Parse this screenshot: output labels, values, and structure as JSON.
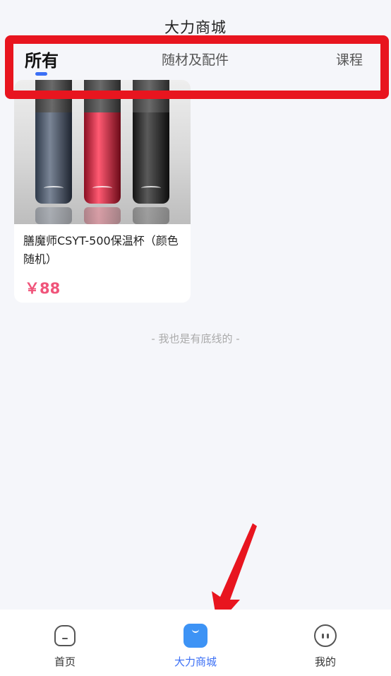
{
  "header": {
    "title": "大力商城"
  },
  "tabs": [
    {
      "label": "所有",
      "active": true
    },
    {
      "label": "随材及配件",
      "active": false
    },
    {
      "label": "课程",
      "active": false
    }
  ],
  "products": [
    {
      "name": "膳魔师CSYT-500保温杯（颜色随机）",
      "price": "￥88"
    }
  ],
  "list_footer": "- 我也是有底线的 -",
  "tab_bar": [
    {
      "label": "首页",
      "icon": "home-icon",
      "active": false
    },
    {
      "label": "大力商城",
      "icon": "shop-icon",
      "active": true
    },
    {
      "label": "我的",
      "icon": "profile-icon",
      "active": false
    }
  ],
  "colors": {
    "accent": "#3b6ff5",
    "price": "#f0547a",
    "annotation": "#e8151f"
  }
}
